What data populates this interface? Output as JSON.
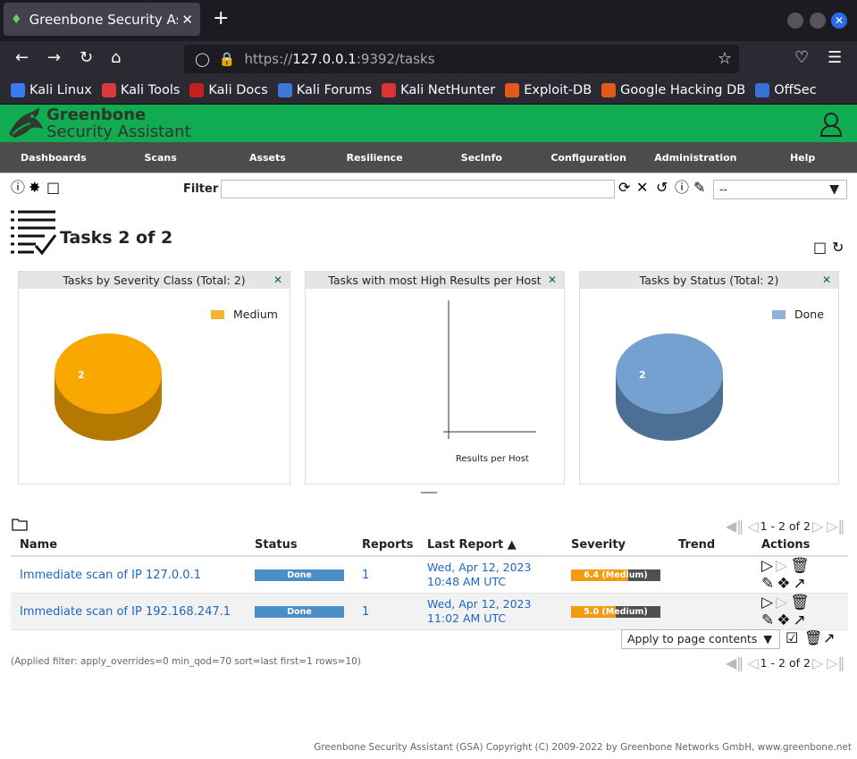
{
  "browser": {
    "tab_title": "Greenbone Security Assista",
    "url_base": "https://",
    "url_host": "127.0.0.1",
    "url_rest": ":9392/tasks",
    "bookmarks": [
      {
        "label": "Kali Linux",
        "color": "#367bf0"
      },
      {
        "label": "Kali Tools",
        "color": "#d63c3c"
      },
      {
        "label": "Kali Docs",
        "color": "#c21f1f"
      },
      {
        "label": "Kali Forums",
        "color": "#3a79d8"
      },
      {
        "label": "Kali NetHunter",
        "color": "#d33"
      },
      {
        "label": "Exploit-DB",
        "color": "#e05a1c"
      },
      {
        "label": "Google Hacking DB",
        "color": "#e05a1c"
      },
      {
        "label": "OffSec",
        "color": "#3a6fd8"
      }
    ]
  },
  "app": {
    "logo_line1": "Greenbone",
    "logo_line2": "Security Assistant",
    "brand_color": "#11ab51"
  },
  "menu": [
    "Dashboards",
    "Scans",
    "Assets",
    "Resilience",
    "SecInfo",
    "Configuration",
    "Administration",
    "Help"
  ],
  "filter": {
    "label": "Filter",
    "value": "",
    "select_value": "--"
  },
  "page": {
    "title": "Tasks 2 of 2"
  },
  "dashboards": [
    {
      "title": "Tasks by Severity Class (Total: 2)",
      "legend": "Medium",
      "color": "#f8a800",
      "value": "2"
    },
    {
      "title": "Tasks with most High Results per Host",
      "xlabel": "Results per Host"
    },
    {
      "title": "Tasks by Status (Total: 2)",
      "legend": "Done",
      "color": "#75a1d0",
      "value": "2"
    }
  ],
  "pagination": {
    "text": "1 - 2 of 2"
  },
  "table": {
    "headers": [
      "Name",
      "Status",
      "Reports",
      "Last Report ▲",
      "Severity",
      "Trend",
      "Actions"
    ],
    "rows": [
      {
        "name": "Immediate scan of IP 127.0.0.1",
        "status": "Done",
        "reports": "1",
        "date1": "Wed, Apr 12, 2023",
        "date2": "10:48 AM UTC",
        "severity": "6.4 (Medium)",
        "severity_value": 6.4
      },
      {
        "name": "Immediate scan of IP 192.168.247.1",
        "status": "Done",
        "reports": "1",
        "date1": "Wed, Apr 12, 2023",
        "date2": "11:02 AM UTC",
        "severity": "5.0 (Medium)",
        "severity_value": 5.0
      }
    ]
  },
  "bulk": {
    "apply_label": "Apply to page contents"
  },
  "applied_filter": "(Applied filter: apply_overrides=0 min_qod=70 sort=last first=1 rows=10)",
  "footer": "Greenbone Security Assistant (GSA) Copyright (C) 2009-2022 by Greenbone Networks GmbH, www.greenbone.net"
}
